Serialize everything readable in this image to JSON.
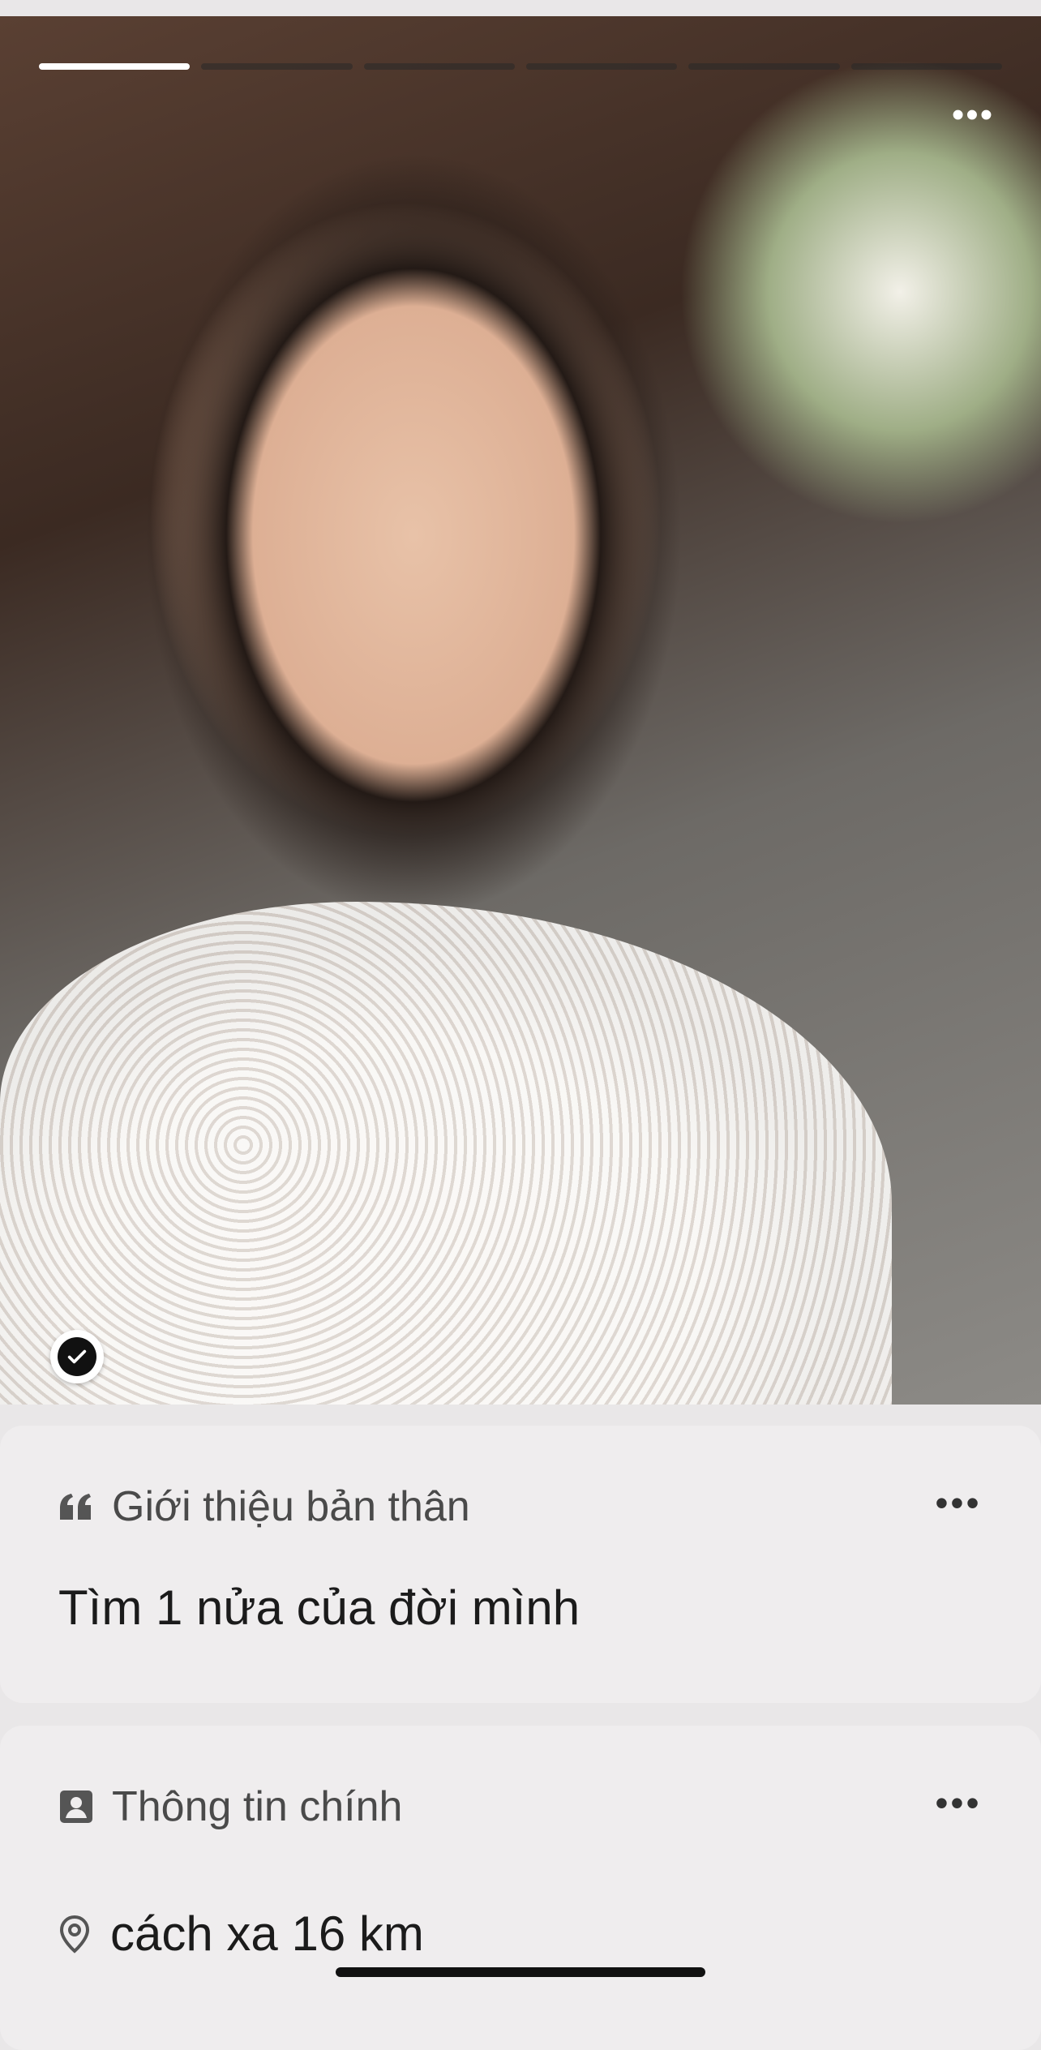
{
  "photo": {
    "progress": {
      "segments": 6,
      "active_index": 0
    },
    "more_icon": "ellipsis-icon",
    "verified_icon": "checkmark-badge-icon"
  },
  "intro_card": {
    "icon": "quote-icon",
    "title": "Giới thiệu bản thân",
    "text": "Tìm 1 nửa của đời mình",
    "more_icon": "ellipsis-icon"
  },
  "info_card": {
    "icon": "contact-card-icon",
    "title": "Thông tin chính",
    "distance": "cách xa 16 km",
    "distance_icon": "location-pin-icon",
    "more_icon": "ellipsis-icon"
  },
  "more_glyph": "•••"
}
